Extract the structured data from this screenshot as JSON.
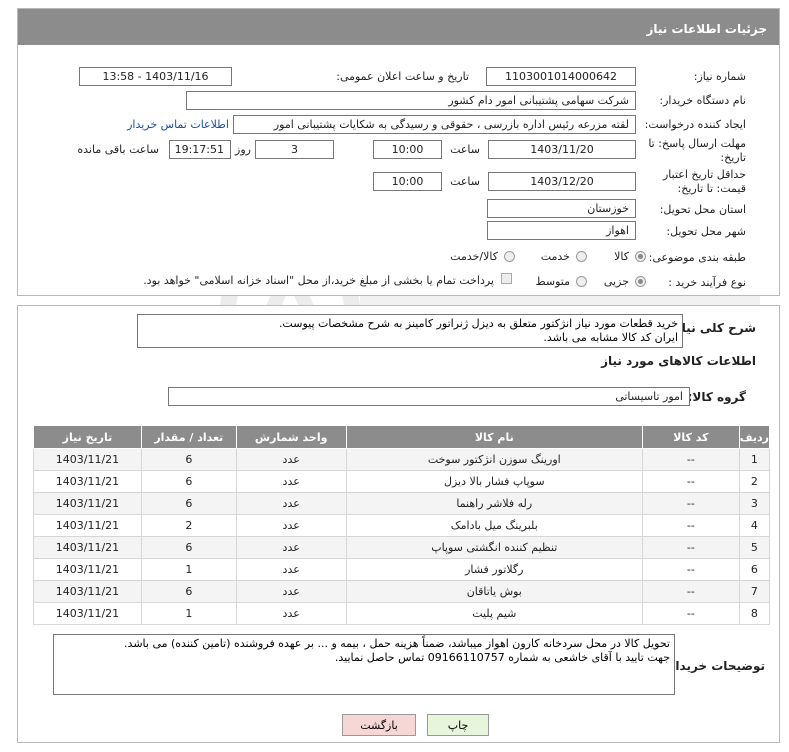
{
  "header": {
    "title": "جزئیات اطلاعات نیاز"
  },
  "fields": {
    "need_number_label": "شماره نیاز:",
    "need_number": "1103001014000642",
    "announce_label": "تاریخ و ساعت اعلان عمومی:",
    "announce_value": "1403/11/16 - 13:58",
    "buyer_org_label": "نام دستگاه خریدار:",
    "buyer_org": "شرکت سهامی پشتیبانی امور دام کشور",
    "requester_label": "ایجاد کننده درخواست:",
    "requester": "لقته مزرعه رئیس اداره بازرسی ، حقوقی و رسیدگی به شکایات  پشتیبانی امور",
    "contact_link": "اطلاعات تماس خریدار",
    "deadline_label": "مهلت ارسال پاسخ: تا تاریخ:",
    "deadline_date": "1403/11/20",
    "time_word": "ساعت",
    "deadline_time": "10:00",
    "days_value": "3",
    "days_word": "روز و",
    "remaining_time": "19:17:51",
    "remaining_label": "ساعت باقی مانده",
    "validity_label": "حداقل تاریخ اعتبار قیمت: تا تاریخ:",
    "validity_date": "1403/12/20",
    "validity_time": "10:00",
    "province_label": "استان محل تحویل:",
    "province": "خوزستان",
    "city_label": "شهر محل تحویل:",
    "city": "اهواز",
    "category_label": "طبقه بندی موضوعی:",
    "category_options": [
      "کالا",
      "خدمت",
      "کالا/خدمت"
    ],
    "process_label": "نوع فرآیند خرید :",
    "process_options": [
      "جزیی",
      "متوسط"
    ],
    "payment_note": "پرداخت تمام یا بخشی از مبلغ خرید،از محل \"اسناد خزانه اسلامی\" خواهد بود."
  },
  "description": {
    "label": "شرح کلی نیاز:",
    "text": "خرید قطعات مورد نیاز انژکتور متعلق به دیزل ژنراتور کامینز به شرح مشخصات پیوست.\nایران کد کالا مشابه می باشد."
  },
  "goods_section_title": "اطلاعات کالاهای مورد نیاز",
  "goods_group": {
    "label": "گروه کالا:",
    "value": "امور تاسیساتی"
  },
  "table": {
    "headers": [
      "ردیف",
      "کد کالا",
      "نام کالا",
      "واحد شمارش",
      "تعداد / مقدار",
      "تاریخ نیاز"
    ],
    "rows": [
      [
        "1",
        "--",
        "اورینگ سوزن انژکتور سوخت",
        "عدد",
        "6",
        "1403/11/21"
      ],
      [
        "2",
        "--",
        "سوپاپ فشار بالا دیزل",
        "عدد",
        "6",
        "1403/11/21"
      ],
      [
        "3",
        "--",
        "رله فلاشر راهنما",
        "عدد",
        "6",
        "1403/11/21"
      ],
      [
        "4",
        "--",
        "بلبرینگ میل بادامک",
        "عدد",
        "2",
        "1403/11/21"
      ],
      [
        "5",
        "--",
        "تنظیم کننده انگشتی سوپاپ",
        "عدد",
        "6",
        "1403/11/21"
      ],
      [
        "6",
        "--",
        "رگلاتور فشار",
        "عدد",
        "1",
        "1403/11/21"
      ],
      [
        "7",
        "--",
        "بوش یاتاقان",
        "عدد",
        "6",
        "1403/11/21"
      ],
      [
        "8",
        "--",
        "شیم پلیت",
        "عدد",
        "1",
        "1403/11/21"
      ]
    ]
  },
  "buyer_notes": {
    "label": "توضیحات خریدار:",
    "text": "تحویل کالا در محل سردخانه کارون اهواز میباشد، ضمناً هزینه حمل ، بیمه و ... بر عهده فروشنده (تامین کننده) می باشد.\nجهت تایید با آقای خاشعی به شماره 09166110757 تماس حاصل نمایید."
  },
  "buttons": {
    "print": "چاپ",
    "back": "بازگشت"
  },
  "colors": {
    "header_bg": "#8c8c8c",
    "link": "#1a4fa3",
    "back_button_bg": "#f7d6d6",
    "print_button_bg": "#e6f5dc"
  }
}
